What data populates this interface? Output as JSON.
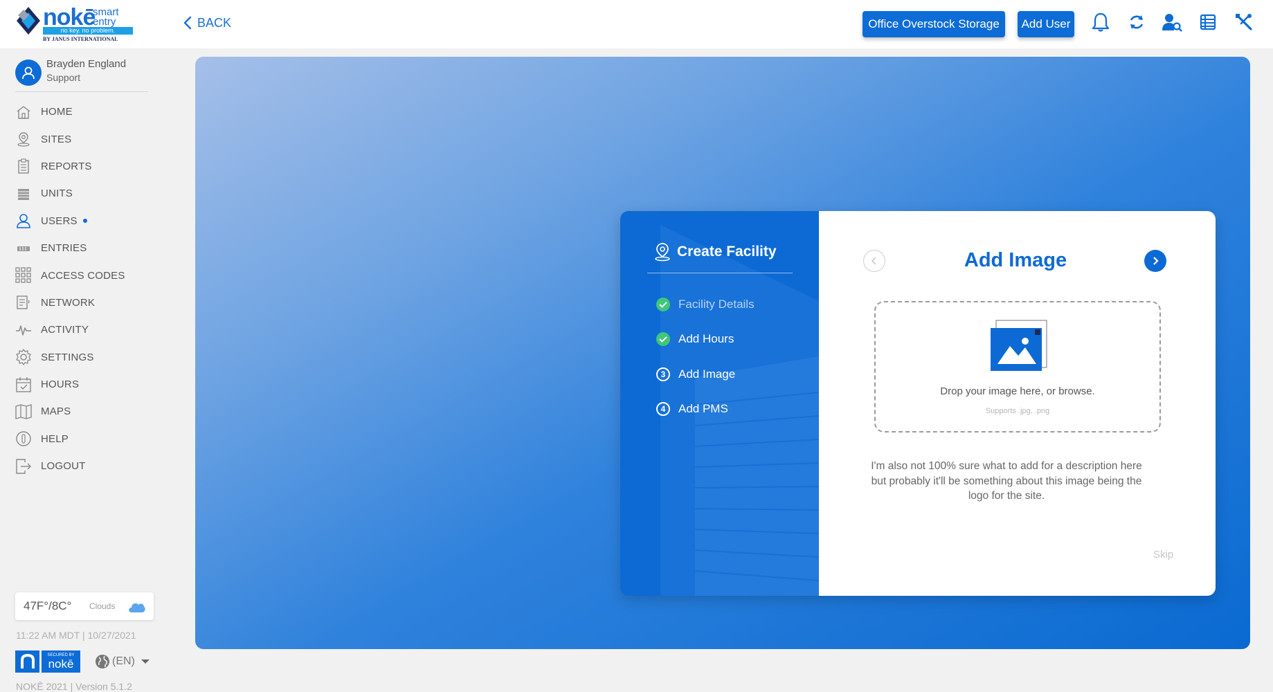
{
  "logo": {
    "word": "nokē",
    "smart": "smart",
    "entry": "entry",
    "tagline": "no key. no problem.",
    "by": "BY JANUS INTERNATIONAL"
  },
  "header": {
    "back_label": "BACK",
    "facility_button": "Office Overstock Storage",
    "add_user_button": "Add User",
    "icons": [
      "bell-icon",
      "sync-icon",
      "user-search-icon",
      "ledger-icon",
      "tools-icon"
    ]
  },
  "user": {
    "name": "Brayden England",
    "role": "Support"
  },
  "nav": [
    {
      "label": "HOME",
      "icon": "home-icon"
    },
    {
      "label": "SITES",
      "icon": "location-pin-icon"
    },
    {
      "label": "REPORTS",
      "icon": "clipboard-icon"
    },
    {
      "label": "UNITS",
      "icon": "units-icon"
    },
    {
      "label": "USERS",
      "icon": "user-icon",
      "active": true
    },
    {
      "label": "ENTRIES",
      "icon": "entries-icon"
    },
    {
      "label": "ACCESS CODES",
      "icon": "keypad-grid-icon"
    },
    {
      "label": "NETWORK",
      "icon": "network-icon"
    },
    {
      "label": "ACTIVITY",
      "icon": "activity-pulse-icon"
    },
    {
      "label": "SETTINGS",
      "icon": "gear-icon"
    },
    {
      "label": "HOURS",
      "icon": "calendar-check-icon"
    },
    {
      "label": "MAPS",
      "icon": "map-icon"
    },
    {
      "label": "HELP",
      "icon": "help-icon"
    },
    {
      "label": "LOGOUT",
      "icon": "logout-icon"
    }
  ],
  "weather": {
    "temp": "47F°/8C°",
    "condition": "Clouds"
  },
  "datetime": "11:22 AM MDT | 10/27/2021",
  "badge": {
    "secured_by": "SECURED BY",
    "brand": "nokē"
  },
  "language": "(EN)",
  "version": "NOKĒ 2021 | Version 5.1.2",
  "modal": {
    "title": "Create Facility",
    "steps": [
      {
        "label": "Facility Details",
        "status": "done-muted"
      },
      {
        "label": "Add Hours",
        "status": "done"
      },
      {
        "label": "Add Image",
        "status": "current",
        "number": "3"
      },
      {
        "label": "Add PMS",
        "status": "pending",
        "number": "4"
      }
    ],
    "page_title": "Add Image",
    "dropzone_text": "Drop your image here, or browse.",
    "dropzone_sub": "Supports .jpg, .png",
    "description": "I'm also not 100% sure what to add for a description here but probably it'll be something about this image being the logo for the site.",
    "skip": "Skip"
  },
  "colors": {
    "primary": "#0d6cd6",
    "accent_green": "#3fc77a",
    "background": "#f1f1f2"
  }
}
